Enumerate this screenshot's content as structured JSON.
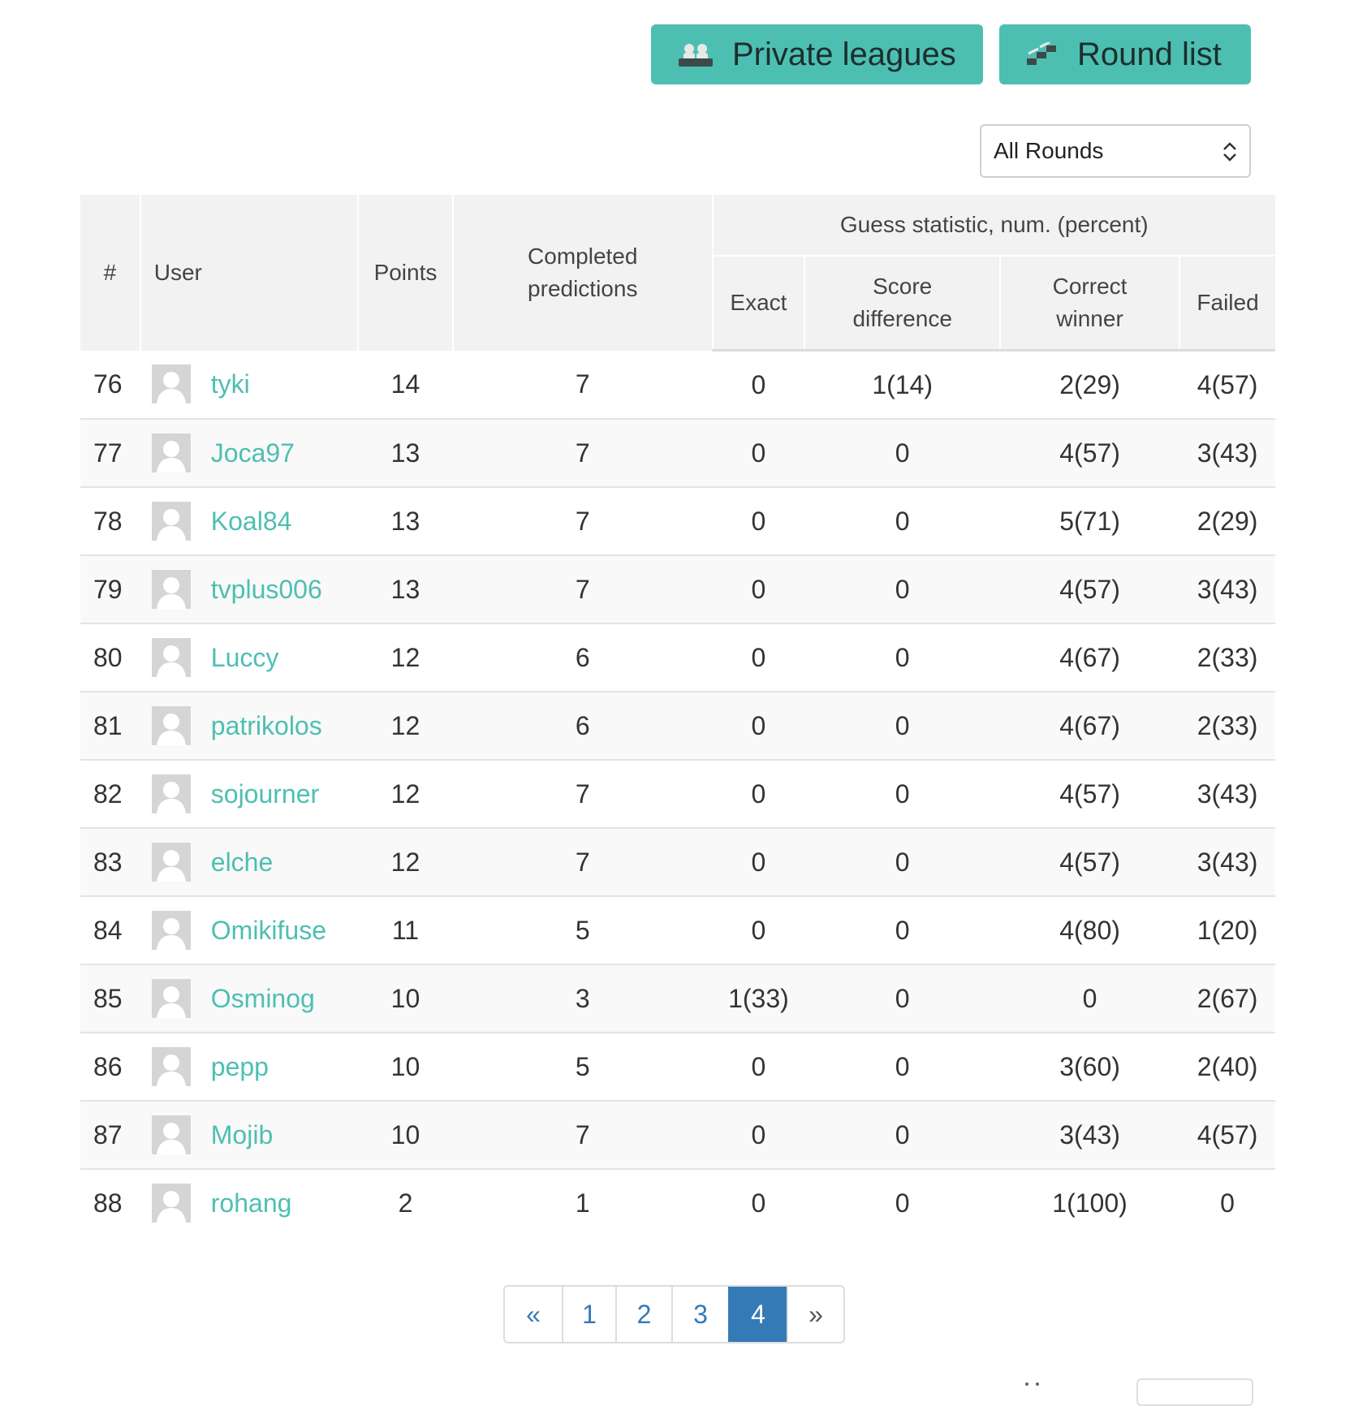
{
  "header": {
    "private_leagues_label": "Private leagues",
    "round_list_label": "Round list"
  },
  "round_select": {
    "value": "All Rounds"
  },
  "table": {
    "headers": {
      "rank": "#",
      "user": "User",
      "points": "Points",
      "completed": "Completed predictions",
      "guess_statistic": "Guess statistic, num. (percent)",
      "exact": "Exact",
      "score_difference": "Score difference",
      "correct_winner": "Correct winner",
      "failed": "Failed"
    },
    "rows": [
      {
        "rank": "76",
        "user": "tyki",
        "points": "14",
        "completed": "7",
        "exact": "0",
        "score_difference": "1(14)",
        "correct_winner": "2(29)",
        "failed": "4(57)"
      },
      {
        "rank": "77",
        "user": "Joca97",
        "points": "13",
        "completed": "7",
        "exact": "0",
        "score_difference": "0",
        "correct_winner": "4(57)",
        "failed": "3(43)"
      },
      {
        "rank": "78",
        "user": "Koal84",
        "points": "13",
        "completed": "7",
        "exact": "0",
        "score_difference": "0",
        "correct_winner": "5(71)",
        "failed": "2(29)"
      },
      {
        "rank": "79",
        "user": "tvplus006",
        "points": "13",
        "completed": "7",
        "exact": "0",
        "score_difference": "0",
        "correct_winner": "4(57)",
        "failed": "3(43)"
      },
      {
        "rank": "80",
        "user": "Luccy",
        "points": "12",
        "completed": "6",
        "exact": "0",
        "score_difference": "0",
        "correct_winner": "4(67)",
        "failed": "2(33)"
      },
      {
        "rank": "81",
        "user": "patrikolos",
        "points": "12",
        "completed": "6",
        "exact": "0",
        "score_difference": "0",
        "correct_winner": "4(67)",
        "failed": "2(33)"
      },
      {
        "rank": "82",
        "user": "sojourner",
        "points": "12",
        "completed": "7",
        "exact": "0",
        "score_difference": "0",
        "correct_winner": "4(57)",
        "failed": "3(43)"
      },
      {
        "rank": "83",
        "user": "elche",
        "points": "12",
        "completed": "7",
        "exact": "0",
        "score_difference": "0",
        "correct_winner": "4(57)",
        "failed": "3(43)"
      },
      {
        "rank": "84",
        "user": "Omikifuse",
        "points": "11",
        "completed": "5",
        "exact": "0",
        "score_difference": "0",
        "correct_winner": "4(80)",
        "failed": "1(20)"
      },
      {
        "rank": "85",
        "user": "Osminog",
        "points": "10",
        "completed": "3",
        "exact": "1(33)",
        "score_difference": "0",
        "correct_winner": "0",
        "failed": "2(67)"
      },
      {
        "rank": "86",
        "user": "pepp",
        "points": "10",
        "completed": "5",
        "exact": "0",
        "score_difference": "0",
        "correct_winner": "3(60)",
        "failed": "2(40)"
      },
      {
        "rank": "87",
        "user": "Mojib",
        "points": "10",
        "completed": "7",
        "exact": "0",
        "score_difference": "0",
        "correct_winner": "3(43)",
        "failed": "4(57)"
      },
      {
        "rank": "88",
        "user": "rohang",
        "points": "2",
        "completed": "1",
        "exact": "0",
        "score_difference": "0",
        "correct_winner": "1(100)",
        "failed": "0"
      }
    ]
  },
  "pagination": {
    "prev": "«",
    "pages": [
      "1",
      "2",
      "3",
      "4"
    ],
    "active_page": "4",
    "next": "»"
  },
  "colors": {
    "accent": "#4dbfb2",
    "pager_active": "#337ab7",
    "header_bg": "#f2f2f2"
  },
  "icons": {
    "private_leagues": "people-group-icon",
    "round_list": "stairs-icon",
    "select": "select-caret-icon",
    "avatar": "default-avatar-icon"
  }
}
